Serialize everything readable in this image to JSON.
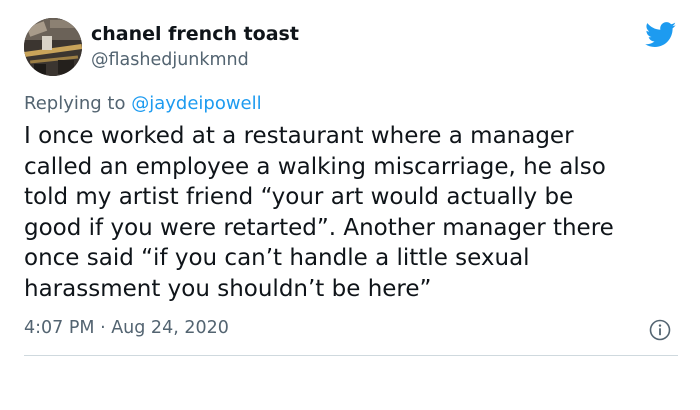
{
  "author": {
    "display_name": "chanel french toast",
    "handle": "@flashedjunkmnd"
  },
  "reply": {
    "prefix": "Replying to ",
    "mention": "@jaydeipowell"
  },
  "tweet": {
    "lines": [
      "I once worked at a restaurant where a manager",
      "called an employee a walking miscarriage, he also",
      "told my artist friend “your art would actually be",
      "good if you were retarted”. Another manager there",
      "once said “if you can’t handle a little sexual",
      "harassment you shouldn’t be here”"
    ]
  },
  "meta": {
    "timestamp": "4:07 PM · Aug 24, 2020"
  },
  "icons": {
    "brand": "twitter-bird-icon",
    "info": "info-icon"
  },
  "colors": {
    "brand_blue": "#1d9bf0",
    "text_primary": "#0f1419",
    "text_secondary": "#536471",
    "divider": "#cfd9de"
  }
}
